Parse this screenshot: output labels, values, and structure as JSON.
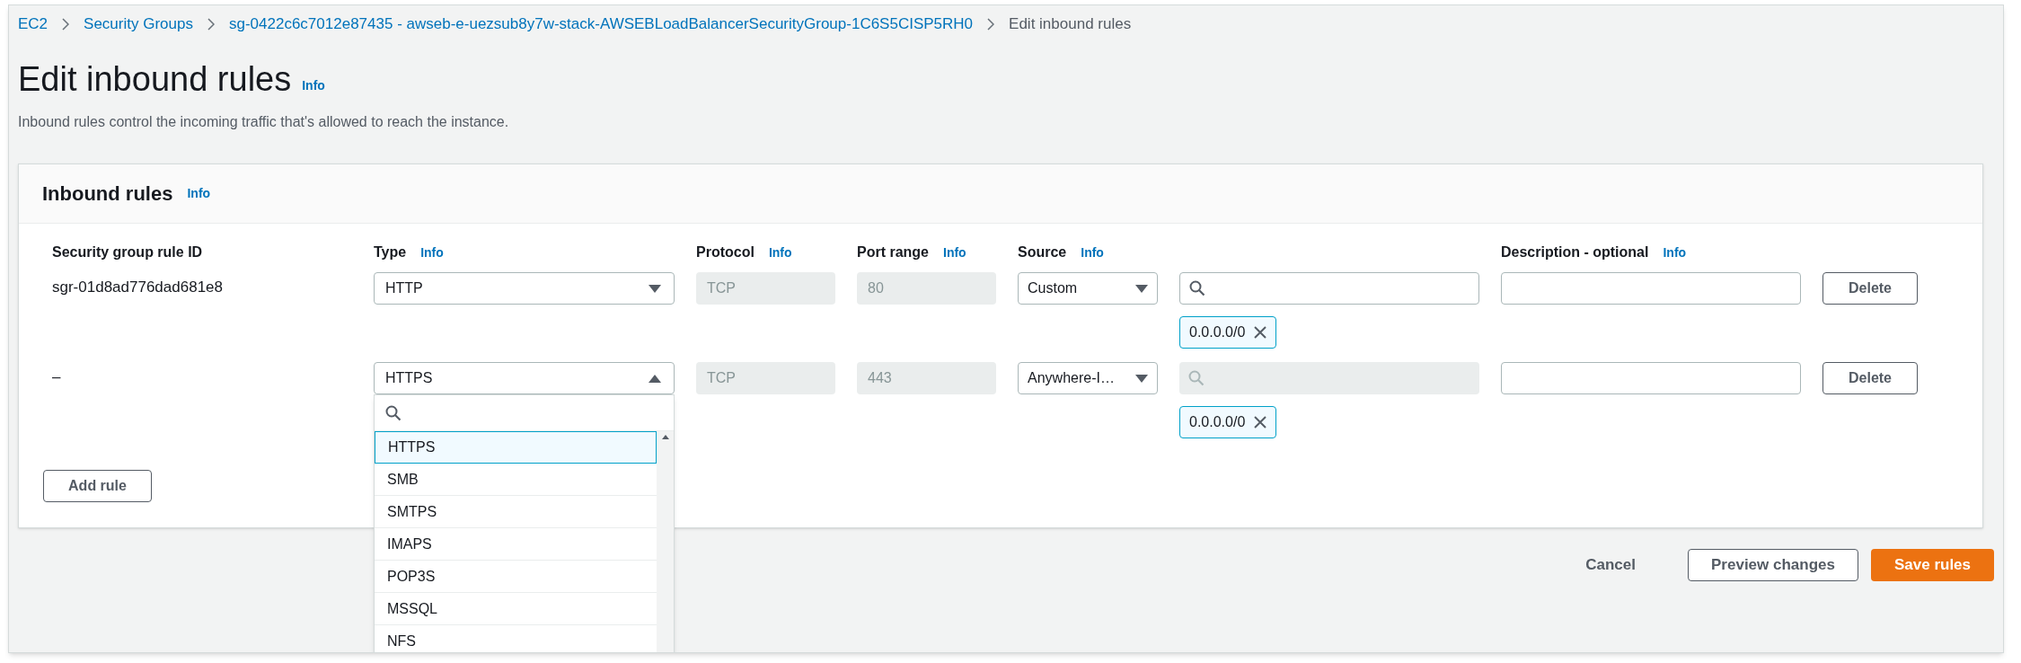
{
  "breadcrumbs": [
    {
      "label": "EC2",
      "current": false
    },
    {
      "label": "Security Groups",
      "current": false
    },
    {
      "label": "sg-0422c6c7012e87435 - awseb-e-uezsub8y7w-stack-AWSEBLoadBalancerSecurityGroup-1C6S5CISP5RH0",
      "current": false
    },
    {
      "label": "Edit inbound rules",
      "current": true
    }
  ],
  "title": "Edit inbound rules",
  "title_info": "Info",
  "description": "Inbound rules control the incoming traffic that's allowed to reach the instance.",
  "card": {
    "title": "Inbound rules",
    "info": "Info",
    "columns": [
      {
        "label": "Security group rule ID"
      },
      {
        "label": "Type",
        "info": "Info"
      },
      {
        "label": "Protocol",
        "info": "Info"
      },
      {
        "label": "Port range",
        "info": "Info"
      },
      {
        "label": "Source",
        "info": "Info"
      },
      {
        "label": "Description - optional",
        "info": "Info"
      }
    ],
    "rules": [
      {
        "id": "sgr-01d8ad776dad681e8",
        "type": "HTTP",
        "expanded": false,
        "protocol": "TCP",
        "port": "80",
        "source": "Custom",
        "search_disabled": false,
        "cidrs": [
          "0.0.0.0/0"
        ],
        "delete": "Delete"
      },
      {
        "id": "–",
        "type": "HTTPS",
        "expanded": true,
        "protocol": "TCP",
        "port": "443",
        "source": "Anywhere-I…",
        "search_disabled": true,
        "cidrs": [
          "0.0.0.0/0"
        ],
        "delete": "Delete",
        "options": [
          {
            "label": "HTTPS",
            "selected": true
          },
          {
            "label": "SMB",
            "selected": false
          },
          {
            "label": "SMTPS",
            "selected": false
          },
          {
            "label": "IMAPS",
            "selected": false
          },
          {
            "label": "POP3S",
            "selected": false
          },
          {
            "label": "MSSQL",
            "selected": false
          },
          {
            "label": "NFS",
            "selected": false
          }
        ]
      }
    ],
    "add_rule": "Add rule"
  },
  "footer": {
    "cancel": "Cancel",
    "preview": "Preview changes",
    "save": "Save rules"
  }
}
